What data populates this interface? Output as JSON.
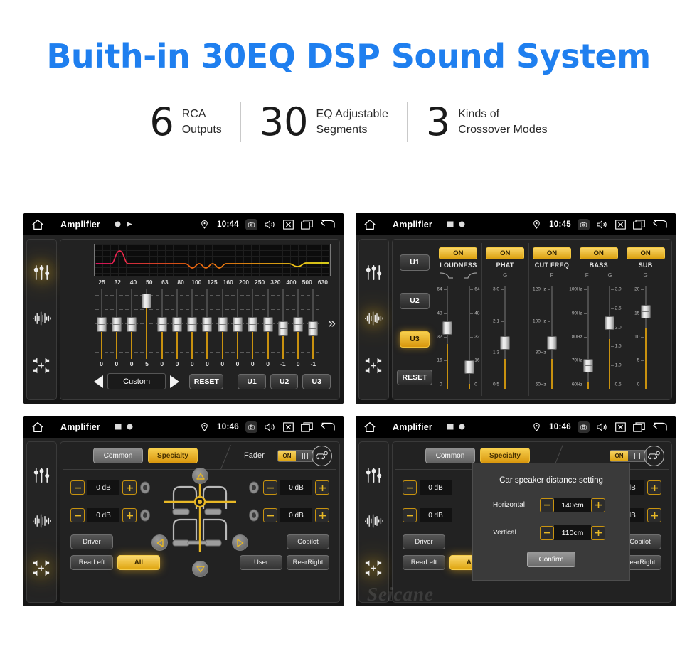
{
  "header": {
    "title": "Buith-in 30EQ DSP Sound System",
    "stats": [
      {
        "num": "6",
        "line1": "RCA",
        "line2": "Outputs"
      },
      {
        "num": "30",
        "line1": "EQ Adjustable",
        "line2": "Segments"
      },
      {
        "num": "3",
        "line1": "Kinds of",
        "line2": "Crossover Modes"
      }
    ]
  },
  "statusbar": {
    "app_title": "Amplifier",
    "home_icon": "home-icon",
    "camera_icon": "camera-icon",
    "volume_icon": "volume-icon",
    "close_icon": "close-box-icon",
    "recents_icon": "recents-icon",
    "back_icon": "back-arrow-icon",
    "location_icon": "location-pin-icon",
    "times": {
      "p1": "10:44",
      "p2": "10:45",
      "p3": "10:46",
      "p4": "10:46"
    }
  },
  "rail": {
    "icons": [
      "eq-sliders-icon",
      "waveform-icon",
      "fader-speakers-icon"
    ]
  },
  "panel_eq": {
    "frequencies": [
      "25",
      "32",
      "40",
      "50",
      "63",
      "80",
      "100",
      "125",
      "160",
      "200",
      "250",
      "320",
      "400",
      "500",
      "630"
    ],
    "values": [
      "0",
      "0",
      "0",
      "5",
      "0",
      "0",
      "0",
      "0",
      "0",
      "0",
      "0",
      "0",
      "-1",
      "0",
      "-1"
    ],
    "preset": "Custom",
    "prev_icon": "triangle-left-icon",
    "next_icon": "triangle-right-icon",
    "expand_icon": "double-chevron-right-icon",
    "reset_label": "RESET",
    "user_presets": [
      "U1",
      "U2",
      "U3"
    ],
    "curve_colors": [
      "#ED1164",
      "#F07A10",
      "#F2D01B"
    ]
  },
  "panel_dsp": {
    "side_buttons": [
      "U1",
      "U2",
      "U3"
    ],
    "active_side_button": "U3",
    "reset_label": "RESET",
    "columns": [
      {
        "name": "LOUDNESS",
        "state": "ON",
        "param_labels": [
          "curve-down-icon",
          "curve-up-icon"
        ],
        "sliders": [
          {
            "ticks": [
              "64",
              "48",
              "32",
              "16",
              "0"
            ],
            "value_pos": 0.52,
            "label_side": "left"
          },
          {
            "ticks": [
              "64",
              "48",
              "32",
              "16",
              "0"
            ],
            "value_pos": 0.02,
            "label_side": "right"
          }
        ]
      },
      {
        "name": "PHAT",
        "state": "ON",
        "param_labels": [
          "G"
        ],
        "sliders": [
          {
            "ticks": [
              "3.0",
              "2.1",
              "1.3",
              "0.5"
            ],
            "value_pos": 0.33,
            "label_side": "left"
          }
        ]
      },
      {
        "name": "CUT FREQ",
        "state": "ON",
        "param_labels": [
          "F"
        ],
        "sliders": [
          {
            "ticks": [
              "120Hz",
              "100Hz",
              "80Hz",
              "60Hz"
            ],
            "value_pos": 0.33,
            "label_side": "left"
          }
        ]
      },
      {
        "name": "BASS",
        "state": "ON",
        "param_labels": [
          "F",
          "G"
        ],
        "sliders": [
          {
            "ticks": [
              "100Hz",
              "90Hz",
              "80Hz",
              "70Hz",
              "60Hz"
            ],
            "value_pos": 0.04,
            "label_side": "left"
          },
          {
            "ticks": [
              "3.0",
              "2.5",
              "2.0",
              "1.5",
              "1.0",
              "0.5"
            ],
            "value_pos": 0.58,
            "label_side": "right"
          }
        ]
      },
      {
        "name": "SUB",
        "state": "ON",
        "param_labels": [
          "G"
        ],
        "sliders": [
          {
            "ticks": [
              "20",
              "15",
              "10",
              "5",
              "0"
            ],
            "value_pos": 0.72,
            "label_side": "left"
          }
        ]
      }
    ]
  },
  "panel_fader": {
    "tab_common": "Common",
    "tab_specialty": "Specialty",
    "active_tab": "Specialty",
    "fader_label": "Fader",
    "fader_state": "ON",
    "car_settings_icon": "car-settings-icon",
    "speaker_icon": "speaker-icon",
    "db_values": [
      "0 dB",
      "0 dB",
      "0 dB",
      "0 dB"
    ],
    "minus_icon": "minus-icon",
    "plus_icon": "plus-icon",
    "nav_up_icon": "triangle-up-icon",
    "nav_down_icon": "triangle-down-icon",
    "nav_left_icon": "triangle-left-icon",
    "nav_right_icon": "triangle-right-icon",
    "seat_buttons": {
      "driver": "Driver",
      "copilot": "Copilot",
      "rear_left": "RearLeft",
      "rear_right": "RearRight",
      "all": "All",
      "user": "User"
    },
    "active_seat": "All"
  },
  "dialog": {
    "title": "Car speaker distance setting",
    "rows": [
      {
        "label": "Horizontal",
        "value": "140cm"
      },
      {
        "label": "Vertical",
        "value": "110cm"
      }
    ],
    "minus_icon": "minus-icon",
    "plus_icon": "plus-icon",
    "confirm_label": "Confirm"
  },
  "watermark": {
    "text": "Seicane"
  },
  "colors": {
    "accent_blue": "#1F7FEF",
    "accent_amber": "#E3A90F",
    "panel_bg": "#222222"
  }
}
